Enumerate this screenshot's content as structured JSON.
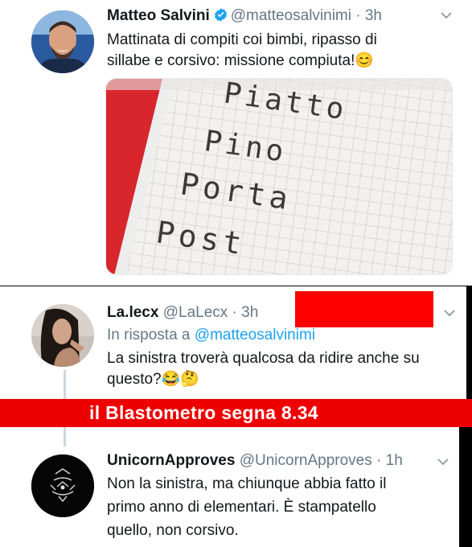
{
  "tweet1": {
    "name": "Matteo Salvini",
    "handle": "@matteosalvinimi",
    "time": "3h",
    "text_lines": [
      "Mattinata di compiti coi bimbi, ripasso di",
      "sillabe e corsivo: missione compiuta!😊"
    ],
    "photo_words": [
      "Piatto",
      "Pino",
      "Porta",
      "Post"
    ]
  },
  "tweet2": {
    "name": "La.lecx",
    "handle": "@LaLecx",
    "time": "3h",
    "reply_prefix": "In risposta a",
    "reply_handle": "@matteosalvinimi",
    "text_lines": [
      "La sinistra troverà qualcosa da ridire anche su",
      "questo?😂🤔"
    ]
  },
  "banner": {
    "text": "il Blastometro segna 8.34",
    "color": "#ee0000"
  },
  "tweet3": {
    "name": "UnicornApproves",
    "handle": "@UnicornApproves",
    "time": "1h",
    "text_lines": [
      "Non la sinistra, ma chiunque abbia fatto il",
      "primo anno di elementari. È stampatello",
      "quello, non corsivo."
    ]
  },
  "colors": {
    "link": "#1da1f2",
    "muted": "#657786",
    "verified": "#1da1f2"
  },
  "icons": [
    "verified-badge-icon",
    "chevron-down-icon"
  ]
}
